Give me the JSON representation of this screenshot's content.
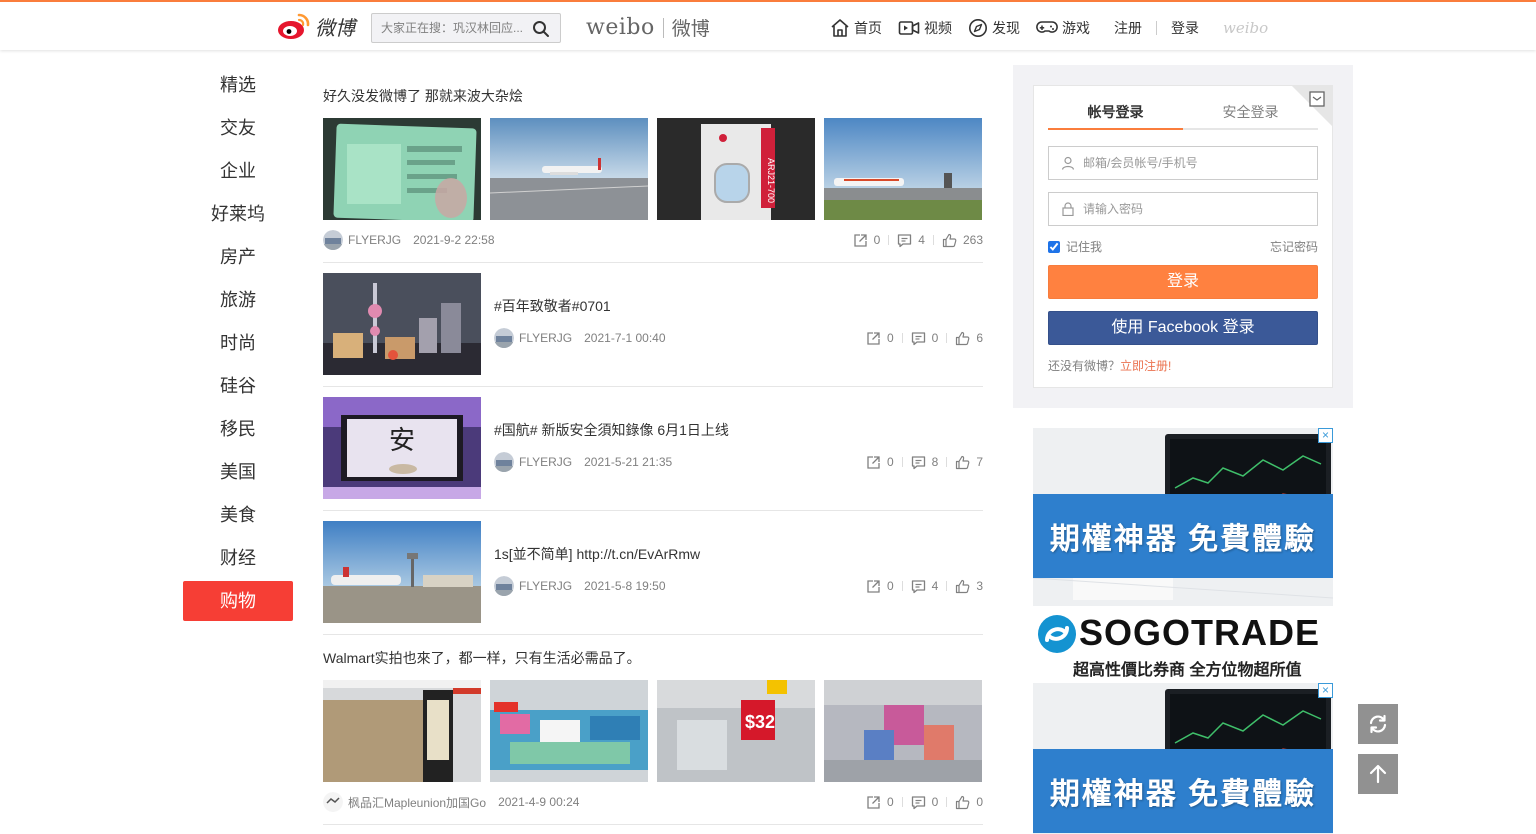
{
  "header": {
    "logo_text": "微博",
    "search_placeholder": "大家正在搜：巩汉林回应...",
    "brand_en": "weibo",
    "brand_cn": "微博",
    "nav": [
      {
        "label": "首页",
        "icon": "home-icon"
      },
      {
        "label": "视频",
        "icon": "video-icon"
      },
      {
        "label": "发现",
        "icon": "discover-icon"
      },
      {
        "label": "游戏",
        "icon": "game-icon"
      }
    ],
    "register": "注册",
    "login": "登录",
    "mini_logo": "weibo"
  },
  "categories": [
    {
      "label": "精选",
      "active": false
    },
    {
      "label": "交友",
      "active": false
    },
    {
      "label": "企业",
      "active": false
    },
    {
      "label": "好莱坞",
      "active": false
    },
    {
      "label": "房产",
      "active": false
    },
    {
      "label": "旅游",
      "active": false
    },
    {
      "label": "时尚",
      "active": false
    },
    {
      "label": "硅谷",
      "active": false
    },
    {
      "label": "移民",
      "active": false
    },
    {
      "label": "美国",
      "active": false
    },
    {
      "label": "美食",
      "active": false
    },
    {
      "label": "财经",
      "active": false
    },
    {
      "label": "购物",
      "active": true
    }
  ],
  "posts": [
    {
      "text": "好久没发微博了 那就来波大杂烩",
      "author": "FLYERJG",
      "time": "2021-9-2 22:58",
      "reposts": "0",
      "comments": "4",
      "likes": "263"
    },
    {
      "text": "#百年致敬者#0701",
      "author": "FLYERJG",
      "time": "2021-7-1 00:40",
      "reposts": "0",
      "comments": "0",
      "likes": "6"
    },
    {
      "text": "#国航# 新版安全須知錄像 6月1日上线",
      "author": "FLYERJG",
      "time": "2021-5-21 21:35",
      "reposts": "0",
      "comments": "8",
      "likes": "7"
    },
    {
      "text": "1s[並不简单] http://t.cn/EvArRmw",
      "author": "FLYERJG",
      "time": "2021-5-8 19:50",
      "reposts": "0",
      "comments": "4",
      "likes": "3"
    },
    {
      "text": "Walmart实拍也來了，都一样，只有生活必需品了。",
      "author": "枫品汇Mapleunion加国Go",
      "time": "2021-4-9 00:24",
      "reposts": "0",
      "comments": "0",
      "likes": "0"
    }
  ],
  "login": {
    "tab_account": "帐号登录",
    "tab_secure": "安全登录",
    "username_placeholder": "邮箱/会员帐号/手机号",
    "password_placeholder": "请输入密码",
    "remember": "记住我",
    "forgot": "忘记密码",
    "login_button": "登录",
    "facebook_button": "使用 Facebook 登录",
    "no_account": "还没有微博？",
    "register_now": "立即注册!"
  },
  "ads": {
    "banner_text": "期權神器 免費體驗",
    "sogo_name": "SOGOTRADE",
    "sogo_tagline": "超高性價比券商 全方位物超所值",
    "close": "×"
  },
  "colors": {
    "accent": "#fa7d3c",
    "active_category": "#f63e35",
    "facebook": "#3b5998"
  }
}
